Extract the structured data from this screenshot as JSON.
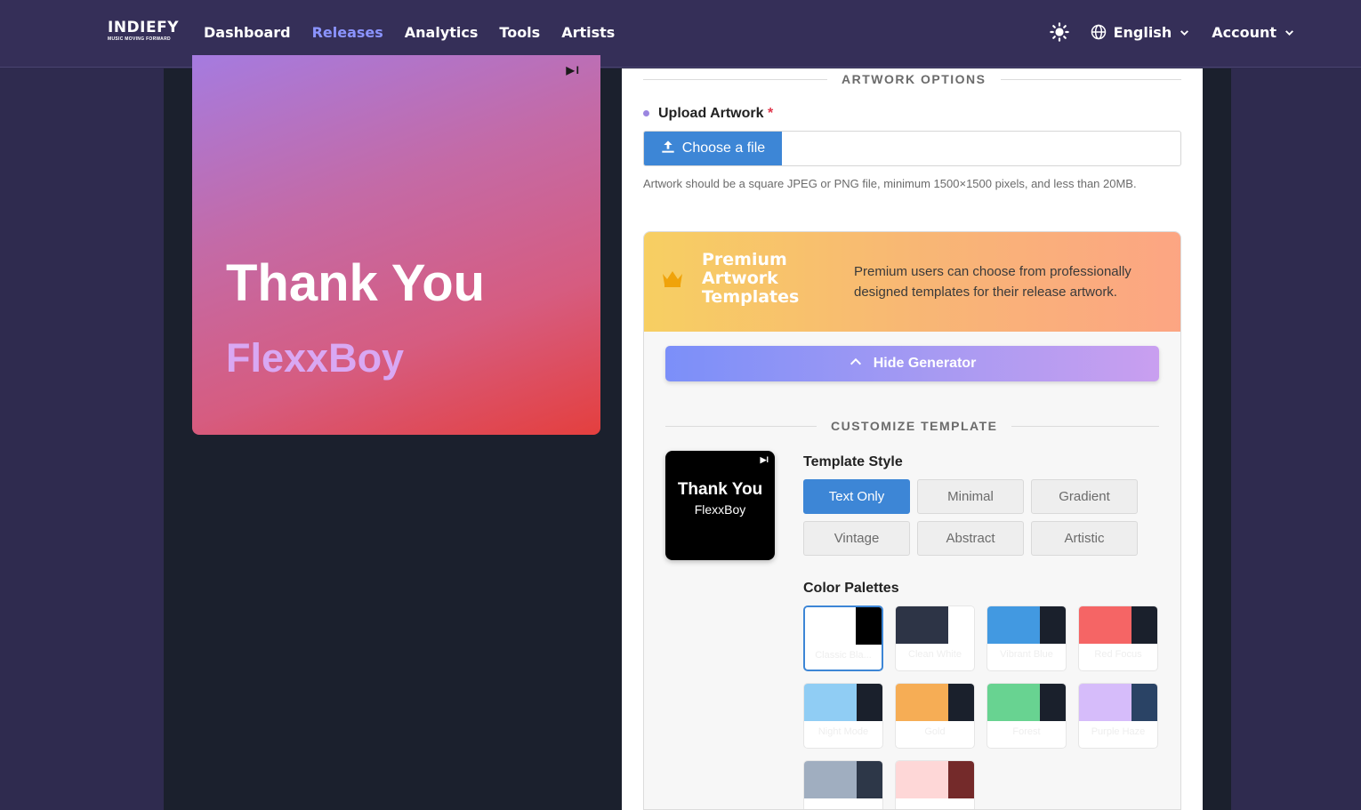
{
  "nav": {
    "logo_word": "INDIEFY",
    "logo_tagline": "MUSIC MOVING FORWARD",
    "links": [
      "Dashboard",
      "Releases",
      "Analytics",
      "Tools",
      "Artists"
    ],
    "active": "Releases",
    "language": "English",
    "account": "Account"
  },
  "preview": {
    "title": "Thank You",
    "artist": "FlexxBoy",
    "mark": "▶I"
  },
  "artwork_options": {
    "section_title": "ARTWORK OPTIONS",
    "upload_label": "Upload Artwork",
    "required_mark": "*",
    "choose_file": "Choose a file",
    "help_text": "Artwork should be a square JPEG or PNG file, minimum 1500×1500 pixels, and less than 20MB."
  },
  "premium": {
    "title": "Premium Artwork Templates",
    "description": "Premium users can choose from professionally designed templates for their release artwork.",
    "hide_button": "Hide Generator",
    "customize_title": "CUSTOMIZE TEMPLATE",
    "mini_title": "Thank You",
    "mini_artist": "FlexxBoy",
    "template_style_label": "Template Style",
    "styles": [
      "Text Only",
      "Minimal",
      "Gradient",
      "Vintage",
      "Abstract",
      "Artistic"
    ],
    "active_style": "Text Only",
    "color_palettes_label": "Color Palettes",
    "palettes": [
      {
        "name": "Classic Bla...",
        "c1": "#ffffff",
        "c2": "#000000",
        "active": true
      },
      {
        "name": "Clean White",
        "c1": "#2d3446",
        "c2": "#ffffff",
        "active": false
      },
      {
        "name": "Vibrant Blue",
        "c1": "#4299e1",
        "c2": "#1a202c",
        "active": false
      },
      {
        "name": "Red Focus",
        "c1": "#f56565",
        "c2": "#1a202c",
        "active": false
      },
      {
        "name": "Night Mode",
        "c1": "#90cdf4",
        "c2": "#1a202c",
        "active": false
      },
      {
        "name": "Gold",
        "c1": "#f6ad55",
        "c2": "#1a202c",
        "active": false
      },
      {
        "name": "Forest",
        "c1": "#68d391",
        "c2": "#1a202c",
        "active": false
      },
      {
        "name": "Purple Haze",
        "c1": "#d6bcfa",
        "c2": "#2a4365",
        "active": false
      },
      {
        "name": "",
        "c1": "#a0aec0",
        "c2": "#2d3748",
        "active": false
      },
      {
        "name": "",
        "c1": "#fed7d7",
        "c2": "#742a2a",
        "active": false
      }
    ]
  },
  "colors": {
    "nav_bg": "#352f58",
    "accent": "#3d86d6",
    "active_link": "#8b94ff"
  }
}
